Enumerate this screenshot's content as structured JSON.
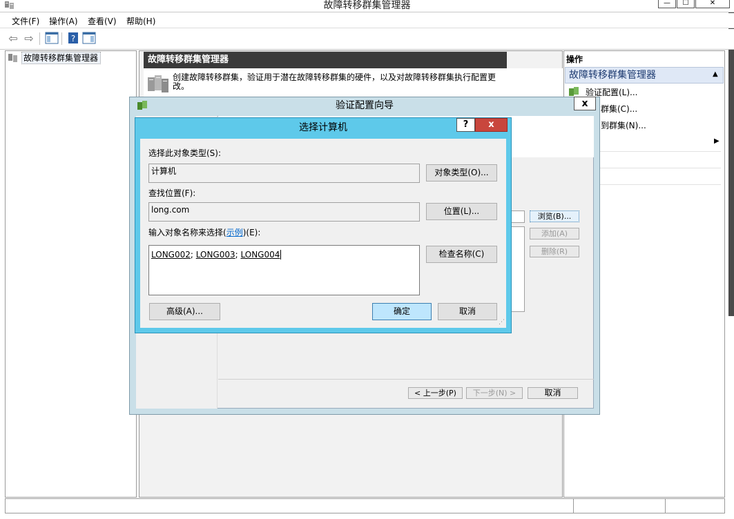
{
  "app": {
    "title": "故障转移群集管理器",
    "controls": {
      "minimize": "—",
      "maximize": "☐",
      "close": "✕"
    }
  },
  "menu": [
    "文件(F)",
    "操作(A)",
    "查看(V)",
    "帮助(H)"
  ],
  "toolbar": {
    "back": "⇦",
    "forward": "⇨",
    "help": "?"
  },
  "tree": {
    "root": "故障转移群集管理器"
  },
  "middle": {
    "header": "故障转移群集管理器",
    "description": "创建故障转移群集，验证用于潜在故障转移群集的硬件，以及对故障转移群集执行配置更改。"
  },
  "actions": {
    "title": "操作",
    "header": "故障转移群集管理器",
    "items": [
      "验证配置(L)...",
      "群集(C)...",
      "到群集(N)...",
      "",
      "",
      "",
      ""
    ]
  },
  "wizard": {
    "title": "验证配置向导",
    "close": "x",
    "browse": "浏览(B)...",
    "add": "添加(A)",
    "remove": "删除(R)",
    "prev": "< 上一步(P)",
    "next": "下一步(N) >",
    "cancel": "取消"
  },
  "select_dialog": {
    "title": "选择计算机",
    "help": "?",
    "close": "x",
    "object_type_label": "选择此对象类型(S):",
    "object_type_value": "计算机",
    "object_type_button": "对象类型(O)...",
    "location_label": "查找位置(F):",
    "location_value": "long.com",
    "location_button": "位置(L)...",
    "names_label_prefix": "输入对象名称来选择(",
    "names_label_link": "示例",
    "names_label_suffix": ")(E):",
    "names": [
      "LONG002",
      "LONG003",
      "LONG004"
    ],
    "names_sep": "; ",
    "check_names_button": "检查名称(C)",
    "advanced_button": "高级(A)...",
    "ok_button": "确定",
    "cancel_button": "取消"
  }
}
